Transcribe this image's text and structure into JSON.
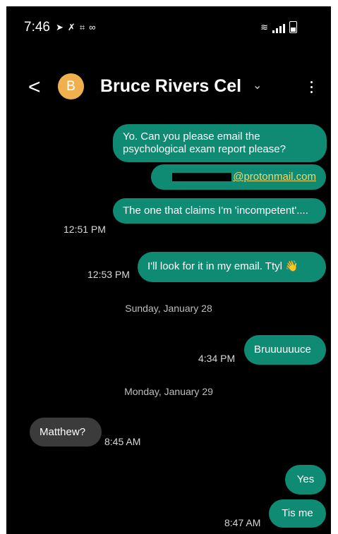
{
  "status_bar": {
    "time": "7:46"
  },
  "header": {
    "avatar_letter": "B",
    "contact_name": "Bruce Rivers Cel"
  },
  "messages": [
    {
      "text": "Yo. Can you please email the psychological exam report please?"
    },
    {
      "link": "@protonmail.com"
    },
    {
      "text": "The one that claims I'm 'incompetent'....",
      "time": "12:51 PM"
    },
    {
      "text": "I'll look for it in my email. Ttyl 👋",
      "time": "12:53 PM"
    },
    {
      "date": "Sunday, January 28"
    },
    {
      "text": "Bruuuuuuce",
      "time": "4:34 PM"
    },
    {
      "date": "Monday, January 29"
    },
    {
      "text": "Matthew?",
      "time": "8:45 AM"
    },
    {
      "text": "Yes"
    },
    {
      "text": "Tis me",
      "time": "8:47 AM"
    }
  ]
}
